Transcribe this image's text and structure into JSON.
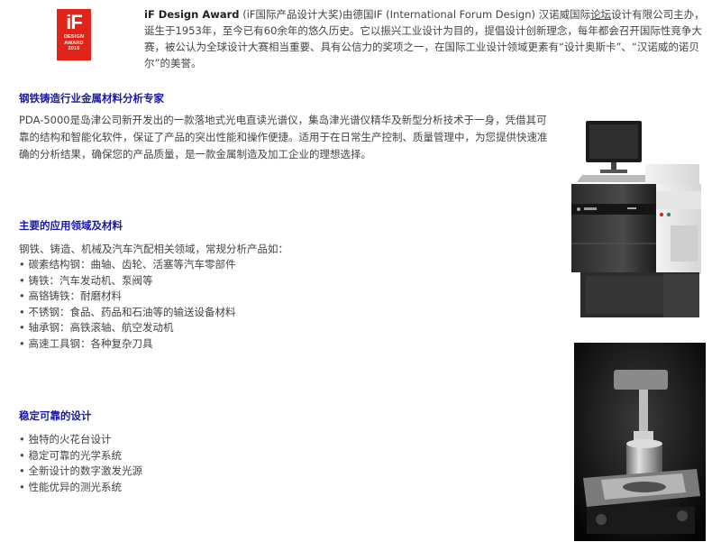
{
  "award": {
    "logo_mark": "iF",
    "logo_lines": [
      "DESIGN",
      "AWARD",
      "2015"
    ],
    "title": "iF Design Award",
    "text_a": " (iF国际产品设计大奖)由德国IF (International Forum Design) 汉诺威国际",
    "link": "论坛",
    "text_b": "设计有限公司主办，诞生于1953年，至今已有60余年的悠久历史。它以振兴工业设计为目的，提倡设计创新理念，每年都会召开国际性竞争大赛，被公认为全球设计大赛相当重要、具有公信力的奖项之一，在国际工业设计领域更素有“设计奥斯卡”、“汉诺威的诺贝尔”的美誉。"
  },
  "sections": {
    "expert": {
      "title": "钢铁铸造行业金属材料分析专家",
      "body": "PDA-5000是岛津公司新开发出的一款落地式光电直读光谱仪，集岛津光谱仪精华及新型分析技术于一身，凭借其可靠的结构和智能化软件，保证了产品的突出性能和操作便捷。适用于在日常生产控制、质量管理中，为您提供快速准确的分析结果，确保您的产品质量，是一款金属制造及加工企业的理想选择。"
    },
    "applications": {
      "title": "主要的应用领域及材料",
      "intro": "钢铁、铸造、机械及汽车汽配相关领域，常规分析产品如：",
      "items": [
        "碳素结构钢：曲轴、齿轮、活塞等汽车零部件",
        "铸铁：汽车发动机、泵阀等",
        "高铬铸铁：耐磨材料",
        "不锈钢：食品、药品和石油等的输送设备材料",
        "轴承钢：高铁滚轴、航空发动机",
        "高速工具钢：各种复杂刀具"
      ]
    },
    "design": {
      "title": "稳定可靠的设计",
      "items": [
        "独特的火花台设计",
        "稳定可靠的光学系统",
        "全新设计的数字激发光源",
        "性能优异的测光系统"
      ]
    }
  },
  "colors": {
    "heading": "#1a1aa8",
    "body": "#444444",
    "logo": "#e2231a"
  }
}
